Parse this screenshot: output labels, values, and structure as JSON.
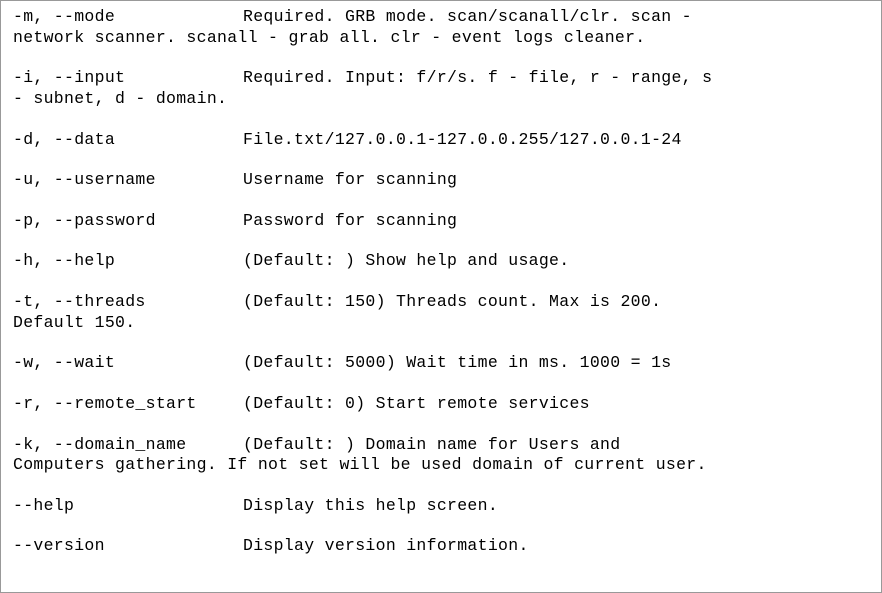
{
  "options": [
    {
      "flag": "-m, --mode",
      "desc_first": "Required. GRB mode. scan/scanall/clr. scan -",
      "desc_cont": "network scanner. scanall - grab all.  clr - event logs cleaner."
    },
    {
      "flag": "-i, --input",
      "desc_first": "Required. Input: f/r/s. f - file, r - range, s",
      "desc_cont": "- subnet, d - domain."
    },
    {
      "flag": "-d, --data",
      "desc_first": "File.txt/127.0.0.1-127.0.0.255/127.0.0.1-24",
      "desc_cont": ""
    },
    {
      "flag": "-u, --username",
      "desc_first": "Username for scanning",
      "desc_cont": ""
    },
    {
      "flag": "-p, --password",
      "desc_first": "Password for scanning",
      "desc_cont": ""
    },
    {
      "flag": "-h, --help",
      "desc_first": "(Default: ) Show help and usage.",
      "desc_cont": ""
    },
    {
      "flag": "-t, --threads",
      "desc_first": "(Default: 150) Threads count. Max is 200.",
      "desc_cont": "Default 150."
    },
    {
      "flag": "-w, --wait",
      "desc_first": "(Default: 5000) Wait time in ms. 1000 = 1s",
      "desc_cont": ""
    },
    {
      "flag": "-r, --remote_start",
      "desc_first": "(Default: 0) Start remote services",
      "desc_cont": ""
    },
    {
      "flag": "-k, --domain_name",
      "desc_first": "(Default: ) Domain name for Users and",
      "desc_cont": "Computers gathering. If not set will be used domain of current user."
    },
    {
      "flag": "--help",
      "desc_first": "Display this help screen.",
      "desc_cont": ""
    },
    {
      "flag": "--version",
      "desc_first": "Display version information.",
      "desc_cont": ""
    }
  ]
}
